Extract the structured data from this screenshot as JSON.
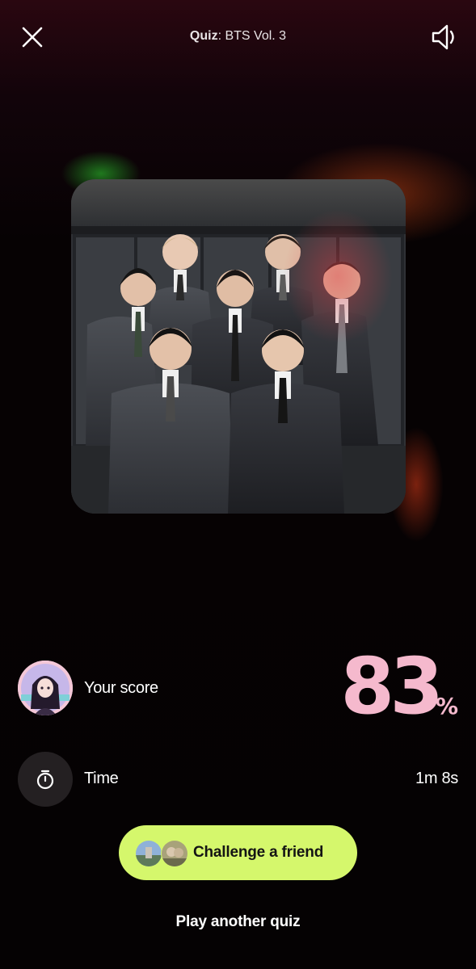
{
  "header": {
    "title_prefix": "Quiz",
    "title_separator": ":",
    "title_name": "BTS Vol. 3",
    "close_icon": "close-icon",
    "sound_icon": "speaker-icon"
  },
  "cover": {
    "icon": "album-cover-photo"
  },
  "score": {
    "label": "Your score",
    "value": "83",
    "unit": "%",
    "color": "#f5b9cd"
  },
  "time": {
    "label": "Time",
    "value": "1m 8s",
    "icon": "stopwatch-icon"
  },
  "actions": {
    "challenge_label": "Challenge a friend",
    "challenge_color": "#d5f76c",
    "play_another_label": "Play another quiz"
  }
}
